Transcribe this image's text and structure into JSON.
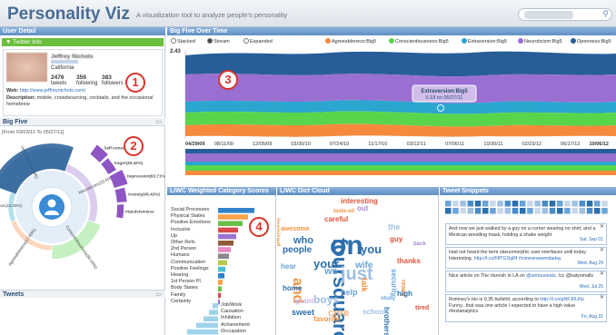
{
  "header": {
    "title": "Personality Viz",
    "subtitle": "A visualization tool to analyze people's personality"
  },
  "left": {
    "user_detail": "User Detail",
    "twitter_info": "Twitter Info",
    "profile": {
      "name": "Jeffrey Nichols",
      "location": "California",
      "tweets_value": "2476",
      "tweets_label": "tweets",
      "following_value": "359",
      "following_label": "following",
      "followers_value": "383",
      "followers_label": "followers",
      "web_label": "Web:",
      "web_url": "http://www.jeffreynichols.com/",
      "desc_label": "Description:",
      "desc_text": "mobile, crowdsourcing, cocktails, and the occasional homebrew"
    },
    "big_five": "Big Five",
    "date_range": "[From 03/03/11 To 05/27/11]",
    "tweets": "Tweets"
  },
  "stream": {
    "title": "Big Five Over Time",
    "radios": [
      "Stacked",
      "Stream",
      "Expanded"
    ],
    "legend": [
      "Agreeableness:Big5",
      "Conscientiousness:Big5",
      "Extraversion:Big5",
      "Neuroticism:Big5",
      "Openness:Big5"
    ],
    "tooltip_title": "Extraversion:Big5",
    "tooltip_value": "0.18 on 05/27/11",
    "y_top": "2.43",
    "x_ticks": [
      "04/29/09",
      "08/11/09",
      "12/05/09",
      "03/30/10",
      "07/24/10",
      "11/17/10",
      "03/12/11",
      "07/06/11",
      "10/30/11",
      "02/23/12",
      "06/17/12",
      "10/06/12"
    ]
  },
  "liwc": {
    "title": "LIWC Weighted Category Scores",
    "categories": [
      "Social Processes",
      "Physical States",
      "Positive Emotions",
      "Inclusive",
      "Up",
      "Other Refs",
      "2nd Person",
      "Humans",
      "Communication",
      "Positive Feelings",
      "Hearing",
      "1st Person Pl.",
      "Body States",
      "Family",
      "Certainty"
    ],
    "categories_lower": [
      "Job/Work",
      "Causation",
      "Inhibition",
      "Achievement",
      "Occupation"
    ]
  },
  "cloud": {
    "title": "LIWC Dict Cloud",
    "words": [
      "interesting",
      "taste-oil",
      "careful",
      "inspired",
      "awesome",
      "who",
      "people",
      "on",
      "foursquare",
      "your",
      "wife",
      "out",
      "just",
      "and",
      "you",
      "we",
      "the",
      "thanks",
      "security",
      "guy",
      "hear",
      "home",
      "boys",
      "ready",
      "help",
      "sweet",
      "grand",
      "core",
      "talk",
      "back",
      "high",
      "study",
      "tired",
      "brothers",
      "school",
      "favorite"
    ]
  },
  "snippets": {
    "title": "Tweet Snippets",
    "cards": [
      {
        "text": "And now we just walked by a guy on a corner wearing no shirt, and a Mexican wrestling mask, holding a shake weight",
        "date": "Sat, Sep 01"
      },
      {
        "text": "Had not heard the term skeuomorphic user interfaces until today. Interesting.",
        "link": "http://t.co/NfTGSqRf #cimeanwwordaday",
        "date": "Wed, Aug 29"
      },
      {
        "text": "Nice article on The Varnish in LA on",
        "link": "@seriouseats",
        "text2": ". /cc @katysmalls",
        "date": "Wed, Jul 25"
      },
      {
        "text": "Romney's bio is 0.35 bullshit, according to",
        "link": "http://t.co/gNFJ0LRp",
        "text2": "Funny...that was one article I expected to have a high value #textanalytics",
        "date": "Fri, Aug 31"
      }
    ]
  },
  "annotations": [
    "1",
    "2",
    "3",
    "4"
  ],
  "colors": {
    "agreeableness": "#f58a3c",
    "conscientiousness": "#59d54c",
    "extraversion": "#2aa6cf",
    "neuroticism": "#9a6fd2",
    "openness": "#275e98",
    "accent": "#5f8fc4",
    "badge": "#d9332a"
  },
  "big_five_wheel": {
    "segments": [
      {
        "label": "Openness(93.00%)",
        "value": 93
      },
      {
        "label": "Neuroticism(33.00%)",
        "value": 33
      },
      {
        "label": "Conscientiousness(60.00%)",
        "value": 60
      },
      {
        "label": "Agreeableness(17.00%)",
        "value": 17
      },
      {
        "label": "Extraversion(13.00%)",
        "value": 13
      }
    ],
    "facets": [
      "Self-consciousness",
      "Anger(40.42%)",
      "Depression(63.71%)",
      "Anxiety(45.42%)",
      "Impulsiveness"
    ]
  }
}
